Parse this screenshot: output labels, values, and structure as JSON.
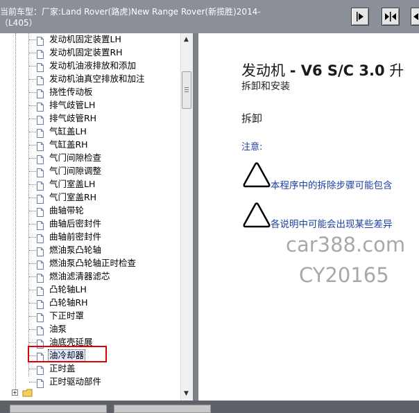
{
  "header": {
    "line1": "当前车型：厂家:Land Rover(路虎)New Range Rover(新揽胜)2014-",
    "line2": "（L405）"
  },
  "toolbar": {
    "buttons": [
      {
        "name": "arrow-right-button",
        "icon": "arrow-right-icon"
      },
      {
        "name": "arrows-inward-button",
        "icon": "arrows-inward-icon"
      },
      {
        "name": "arrow-left-button",
        "icon": "arrow-left-icon"
      }
    ]
  },
  "tree": {
    "items": [
      "发动机固定装置LH",
      "发动机固定装置RH",
      "发动机油液排放和添加",
      "发动机油真空排放和加注",
      "挠性传动板",
      "排气歧管LH",
      "排气歧管RH",
      "气缸盖LH",
      "气缸盖RH",
      "气门间隙检查",
      "气门间隙调整",
      "气门室盖LH",
      "气门室盖RH",
      "曲轴带轮",
      "曲轴后密封件",
      "曲轴前密封件",
      "燃油泵凸轮轴",
      "燃油泵凸轮轴正时检查",
      "燃油滤清器滤芯",
      "凸轮轴LH",
      "凸轮轴RH",
      "下正时罩",
      "油泵",
      "油底壳延展",
      "油冷却器",
      "正时盖",
      "正时驱动部件"
    ],
    "selected_index": 24,
    "folder_expand_symbol": "+",
    "scroll_up": "▲",
    "scroll_down": "▼"
  },
  "document": {
    "title_prefix": "发动机",
    "title_bold": "- V6 S/C 3.0",
    "title_suffix": "升",
    "subtitle": "拆卸和安装",
    "section": "拆卸",
    "note_label": "注意:",
    "warnings": [
      "本程序中的拆除步骤可能包含",
      "各说明中可能会出现某些差异"
    ],
    "watermark_line1": "car388.com",
    "watermark_line2": "CY20165"
  },
  "colors": {
    "titlebar": "#8a8f98",
    "note_text": "#1a3fa0",
    "selection_box": "#e00000",
    "watermark": "#a8a8a8"
  }
}
